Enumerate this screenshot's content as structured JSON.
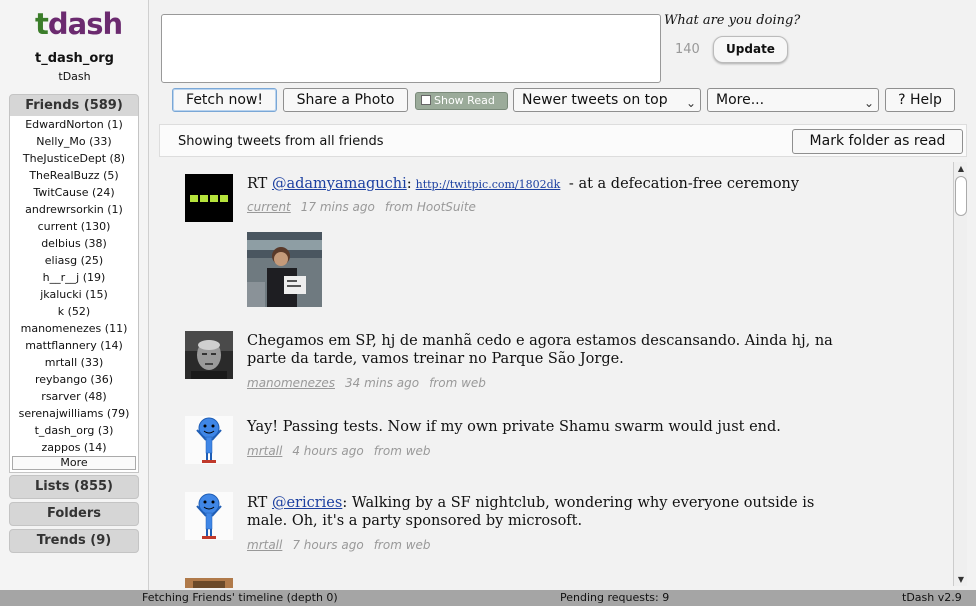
{
  "app": {
    "logo_t": "t",
    "logo_dash": "dash",
    "username": "t_dash_org",
    "app_name": "tDash"
  },
  "sidebar": {
    "friends_label": "Friends (589)",
    "friends": [
      "EdwardNorton (1)",
      "Nelly_Mo (33)",
      "TheJusticeDept (8)",
      "TheRealBuzz (5)",
      "TwitCause (24)",
      "andrewrsorkin (1)",
      "current (130)",
      "delbius (38)",
      "eliasg (25)",
      "h__r__j (19)",
      "jkalucki (15)",
      "k (52)",
      "manomenezes (11)",
      "mattflannery (14)",
      "mrtall (33)",
      "reybango (36)",
      "rsarver (48)",
      "serenajwilliams (79)",
      "t_dash_org (3)",
      "zappos (14)"
    ],
    "more_label": "More",
    "lists_label": "Lists (855)",
    "folders_label": "Folders",
    "trends_label": "Trends (9)"
  },
  "compose": {
    "prompt": "What are you doing?",
    "char_count": "140",
    "update_label": "Update"
  },
  "toolbar": {
    "fetch_label": "Fetch now!",
    "share_label": "Share a Photo",
    "show_read_label": "Show Read",
    "sort_value": "Newer tweets on top",
    "more_value": "More...",
    "help_label": "? Help"
  },
  "timeline": {
    "showing_text": "Showing tweets from all friends",
    "mark_read_label": "Mark folder as read",
    "tweets": [
      {
        "prefix": "RT ",
        "mention": "@adamyamaguchi",
        "colon": ":",
        "url": "http://twitpic.com/1802dk",
        "rest": " - at a defecation-free ceremony",
        "user": "current",
        "time": "17 mins ago",
        "source": "from HootSuite"
      },
      {
        "text": "Chegamos em SP, hj de manhã cedo e agora estamos descansando. Ainda hj, na parte da tarde, vamos treinar no Parque São Jorge.",
        "user": "manomenezes",
        "time": "34 mins ago",
        "source": "from web"
      },
      {
        "text": "Yay! Passing tests. Now if my own private Shamu swarm would just end.",
        "user": "mrtall",
        "time": "4 hours ago",
        "source": "from web"
      },
      {
        "prefix": "RT ",
        "mention": "@ericries",
        "rest": ": Walking by a SF nightclub, wondering why everyone outside is male. Oh, it's a party sponsored by microsoft.",
        "user": "mrtall",
        "time": "7 hours ago",
        "source": "from web"
      }
    ]
  },
  "statusbar": {
    "left": "Fetching Friends' timeline (depth 0)",
    "middle": "Pending requests: 9",
    "right": "tDash v2.9"
  }
}
